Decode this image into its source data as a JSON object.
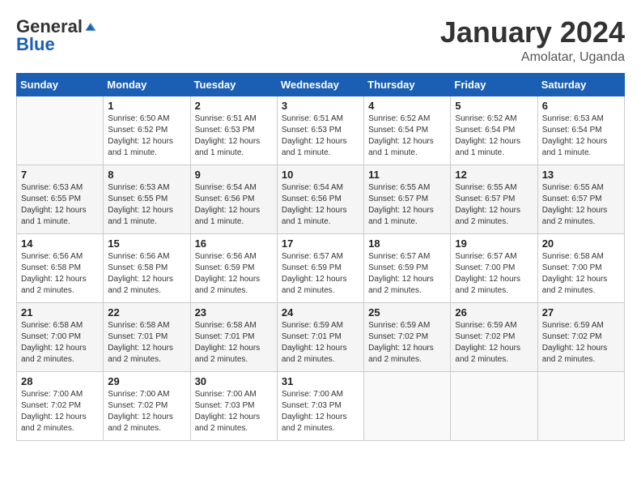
{
  "logo": {
    "general": "General",
    "blue": "Blue"
  },
  "title": {
    "month": "January 2024",
    "location": "Amolatar, Uganda"
  },
  "headers": [
    "Sunday",
    "Monday",
    "Tuesday",
    "Wednesday",
    "Thursday",
    "Friday",
    "Saturday"
  ],
  "weeks": [
    [
      {
        "day": "",
        "sunrise": "",
        "sunset": "",
        "daylight": ""
      },
      {
        "day": "1",
        "sunrise": "Sunrise: 6:50 AM",
        "sunset": "Sunset: 6:52 PM",
        "daylight": "Daylight: 12 hours and 1 minute."
      },
      {
        "day": "2",
        "sunrise": "Sunrise: 6:51 AM",
        "sunset": "Sunset: 6:53 PM",
        "daylight": "Daylight: 12 hours and 1 minute."
      },
      {
        "day": "3",
        "sunrise": "Sunrise: 6:51 AM",
        "sunset": "Sunset: 6:53 PM",
        "daylight": "Daylight: 12 hours and 1 minute."
      },
      {
        "day": "4",
        "sunrise": "Sunrise: 6:52 AM",
        "sunset": "Sunset: 6:54 PM",
        "daylight": "Daylight: 12 hours and 1 minute."
      },
      {
        "day": "5",
        "sunrise": "Sunrise: 6:52 AM",
        "sunset": "Sunset: 6:54 PM",
        "daylight": "Daylight: 12 hours and 1 minute."
      },
      {
        "day": "6",
        "sunrise": "Sunrise: 6:53 AM",
        "sunset": "Sunset: 6:54 PM",
        "daylight": "Daylight: 12 hours and 1 minute."
      }
    ],
    [
      {
        "day": "7",
        "sunrise": "Sunrise: 6:53 AM",
        "sunset": "Sunset: 6:55 PM",
        "daylight": "Daylight: 12 hours and 1 minute."
      },
      {
        "day": "8",
        "sunrise": "Sunrise: 6:53 AM",
        "sunset": "Sunset: 6:55 PM",
        "daylight": "Daylight: 12 hours and 1 minute."
      },
      {
        "day": "9",
        "sunrise": "Sunrise: 6:54 AM",
        "sunset": "Sunset: 6:56 PM",
        "daylight": "Daylight: 12 hours and 1 minute."
      },
      {
        "day": "10",
        "sunrise": "Sunrise: 6:54 AM",
        "sunset": "Sunset: 6:56 PM",
        "daylight": "Daylight: 12 hours and 1 minute."
      },
      {
        "day": "11",
        "sunrise": "Sunrise: 6:55 AM",
        "sunset": "Sunset: 6:57 PM",
        "daylight": "Daylight: 12 hours and 1 minute."
      },
      {
        "day": "12",
        "sunrise": "Sunrise: 6:55 AM",
        "sunset": "Sunset: 6:57 PM",
        "daylight": "Daylight: 12 hours and 2 minutes."
      },
      {
        "day": "13",
        "sunrise": "Sunrise: 6:55 AM",
        "sunset": "Sunset: 6:57 PM",
        "daylight": "Daylight: 12 hours and 2 minutes."
      }
    ],
    [
      {
        "day": "14",
        "sunrise": "Sunrise: 6:56 AM",
        "sunset": "Sunset: 6:58 PM",
        "daylight": "Daylight: 12 hours and 2 minutes."
      },
      {
        "day": "15",
        "sunrise": "Sunrise: 6:56 AM",
        "sunset": "Sunset: 6:58 PM",
        "daylight": "Daylight: 12 hours and 2 minutes."
      },
      {
        "day": "16",
        "sunrise": "Sunrise: 6:56 AM",
        "sunset": "Sunset: 6:59 PM",
        "daylight": "Daylight: 12 hours and 2 minutes."
      },
      {
        "day": "17",
        "sunrise": "Sunrise: 6:57 AM",
        "sunset": "Sunset: 6:59 PM",
        "daylight": "Daylight: 12 hours and 2 minutes."
      },
      {
        "day": "18",
        "sunrise": "Sunrise: 6:57 AM",
        "sunset": "Sunset: 6:59 PM",
        "daylight": "Daylight: 12 hours and 2 minutes."
      },
      {
        "day": "19",
        "sunrise": "Sunrise: 6:57 AM",
        "sunset": "Sunset: 7:00 PM",
        "daylight": "Daylight: 12 hours and 2 minutes."
      },
      {
        "day": "20",
        "sunrise": "Sunrise: 6:58 AM",
        "sunset": "Sunset: 7:00 PM",
        "daylight": "Daylight: 12 hours and 2 minutes."
      }
    ],
    [
      {
        "day": "21",
        "sunrise": "Sunrise: 6:58 AM",
        "sunset": "Sunset: 7:00 PM",
        "daylight": "Daylight: 12 hours and 2 minutes."
      },
      {
        "day": "22",
        "sunrise": "Sunrise: 6:58 AM",
        "sunset": "Sunset: 7:01 PM",
        "daylight": "Daylight: 12 hours and 2 minutes."
      },
      {
        "day": "23",
        "sunrise": "Sunrise: 6:58 AM",
        "sunset": "Sunset: 7:01 PM",
        "daylight": "Daylight: 12 hours and 2 minutes."
      },
      {
        "day": "24",
        "sunrise": "Sunrise: 6:59 AM",
        "sunset": "Sunset: 7:01 PM",
        "daylight": "Daylight: 12 hours and 2 minutes."
      },
      {
        "day": "25",
        "sunrise": "Sunrise: 6:59 AM",
        "sunset": "Sunset: 7:02 PM",
        "daylight": "Daylight: 12 hours and 2 minutes."
      },
      {
        "day": "26",
        "sunrise": "Sunrise: 6:59 AM",
        "sunset": "Sunset: 7:02 PM",
        "daylight": "Daylight: 12 hours and 2 minutes."
      },
      {
        "day": "27",
        "sunrise": "Sunrise: 6:59 AM",
        "sunset": "Sunset: 7:02 PM",
        "daylight": "Daylight: 12 hours and 2 minutes."
      }
    ],
    [
      {
        "day": "28",
        "sunrise": "Sunrise: 7:00 AM",
        "sunset": "Sunset: 7:02 PM",
        "daylight": "Daylight: 12 hours and 2 minutes."
      },
      {
        "day": "29",
        "sunrise": "Sunrise: 7:00 AM",
        "sunset": "Sunset: 7:02 PM",
        "daylight": "Daylight: 12 hours and 2 minutes."
      },
      {
        "day": "30",
        "sunrise": "Sunrise: 7:00 AM",
        "sunset": "Sunset: 7:03 PM",
        "daylight": "Daylight: 12 hours and 2 minutes."
      },
      {
        "day": "31",
        "sunrise": "Sunrise: 7:00 AM",
        "sunset": "Sunset: 7:03 PM",
        "daylight": "Daylight: 12 hours and 2 minutes."
      },
      {
        "day": "",
        "sunrise": "",
        "sunset": "",
        "daylight": ""
      },
      {
        "day": "",
        "sunrise": "",
        "sunset": "",
        "daylight": ""
      },
      {
        "day": "",
        "sunrise": "",
        "sunset": "",
        "daylight": ""
      }
    ]
  ]
}
